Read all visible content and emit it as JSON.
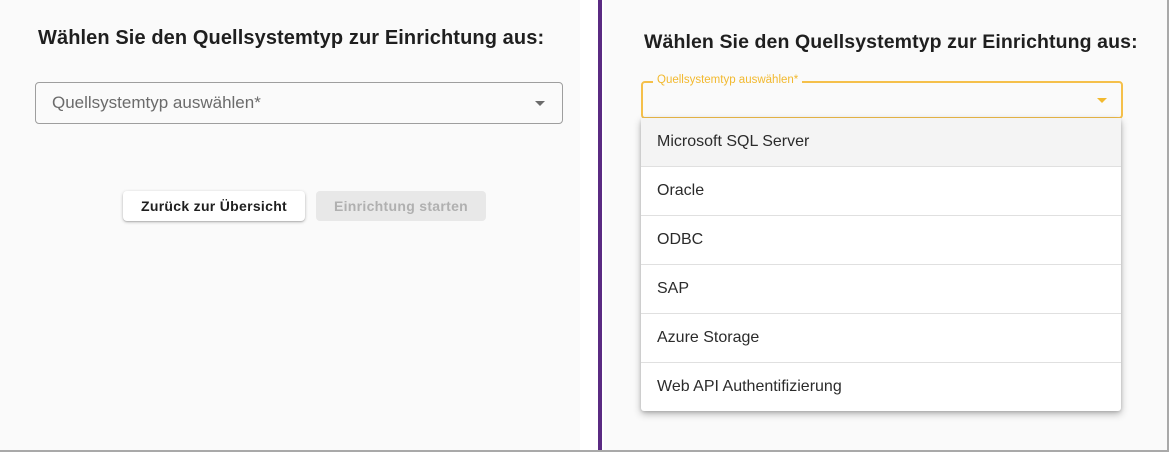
{
  "left_panel": {
    "title": "Wählen Sie den Quellsystemtyp zur Einrichtung aus:",
    "select_placeholder": "Quellsystemtyp auswählen*",
    "back_button": "Zurück zur Übersicht",
    "start_button": "Einrichtung starten"
  },
  "right_panel": {
    "title": "Wählen Sie den Quellsystemtyp zur Einrichtung aus:",
    "select_label": "Quellsystemtyp auswählen*",
    "options": [
      {
        "label": "Microsoft SQL Server"
      },
      {
        "label": "Oracle"
      },
      {
        "label": "ODBC"
      },
      {
        "label": "SAP"
      },
      {
        "label": "Azure Storage"
      },
      {
        "label": "Web API Authentifizierung"
      }
    ]
  },
  "colors": {
    "accent": "#f2b92f",
    "divider": "#5a2a82"
  }
}
